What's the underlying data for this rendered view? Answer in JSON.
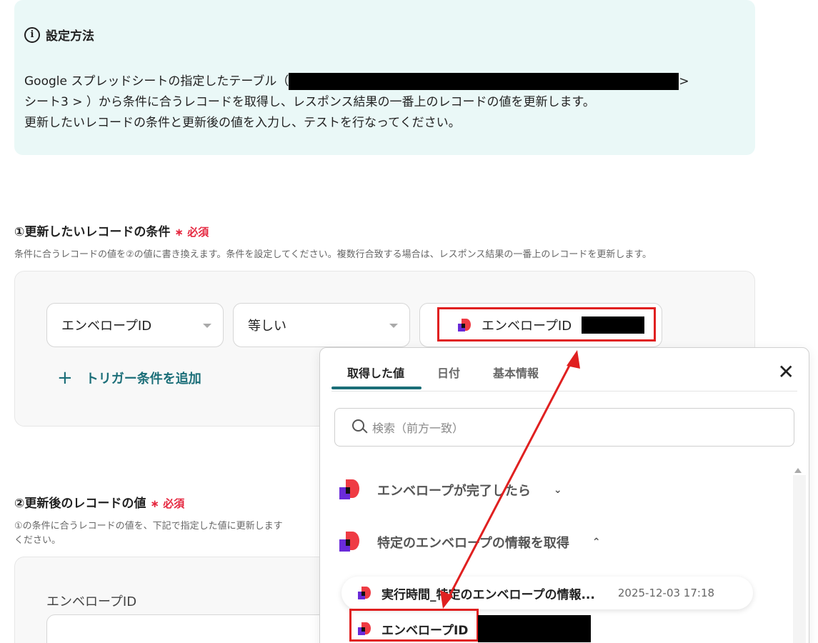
{
  "info": {
    "heading": "設定方法",
    "line1_prefix": "Google スプレッドシートの指定したテーブル（",
    "line1_suffix": ">",
    "line2": "シート3 > ）から条件に合うレコードを取得し、レスポンス結果の一番上のレコードの値を更新します。",
    "line3": "更新したいレコードの条件と更新後の値を入力し、テストを行なってください。"
  },
  "section1": {
    "title": "①更新したいレコードの条件",
    "required": "∗ 必須",
    "description": "条件に合うレコードの値を②の値に書き換えます。条件を設定してください。複数行合致する場合は、レスポンス結果の一番上のレコードを更新します。",
    "field_select": "エンベロープID",
    "operator_select": "等しい",
    "value_chip": "エンベロープID",
    "add_trigger": "トリガー条件を追加"
  },
  "section2": {
    "title": "②更新後のレコードの値",
    "required": "∗ 必須",
    "description_line1": "①の条件に合うレコードの値を、下記で指定した値に更新します",
    "description_line2": "ください。",
    "field_label": "エンベロープID"
  },
  "dropdown": {
    "tabs": [
      "取得した値",
      "日付",
      "基本情報"
    ],
    "close": "✕",
    "search_placeholder": "検索（前方一致）",
    "groups": [
      {
        "label": "エンベロープが完了したら",
        "chevron": "⌄"
      },
      {
        "label": "特定のエンベロープの情報を取得",
        "chevron": "⌃"
      }
    ],
    "items": [
      {
        "name": "実行時間_特定のエンベロープの情報...",
        "time": "2025-12-03 17:18"
      },
      {
        "name": "エンベロープID"
      }
    ]
  },
  "colors": {
    "accent_teal": "#1b6e78",
    "required_red": "#e5273f",
    "highlight_red": "#e02020",
    "info_bg": "#eaf8f7"
  }
}
